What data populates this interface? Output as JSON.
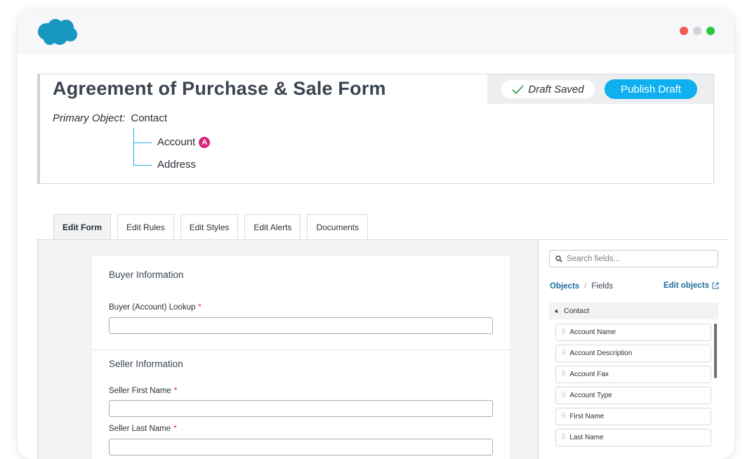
{
  "window": {
    "logo_icon": "salesforce-cloud-logo",
    "controls": [
      {
        "name": "close-dot",
        "color": "#f05b51"
      },
      {
        "name": "minimize-dot",
        "color": "#cfd2d6"
      },
      {
        "name": "maximize-dot",
        "color": "#27c93f"
      }
    ]
  },
  "header": {
    "title": "Agreement of Purchase & Sale Form",
    "draft_status": "Draft Saved",
    "publish_label": "Publish Draft",
    "primary_label": "Primary Object:",
    "primary_value": "Contact",
    "related": [
      {
        "label": "Account",
        "badge": "A"
      },
      {
        "label": "Address"
      }
    ]
  },
  "tabs": [
    "Edit Form",
    "Edit Rules",
    "Edit Styles",
    "Edit Alerts",
    "Documents"
  ],
  "form": {
    "sections": [
      {
        "title": "Buyer Information",
        "fields": [
          {
            "label": "Buyer (Account) Lookup",
            "required": "*",
            "value": ""
          }
        ]
      },
      {
        "title": "Seller Information",
        "fields": [
          {
            "label": "Seller First Name",
            "required": "*",
            "value": ""
          },
          {
            "label": "Seller Last Name",
            "required": "*",
            "value": ""
          }
        ]
      }
    ]
  },
  "panel": {
    "search_placeholder": "Search fields...",
    "crumb_objects": "Objects",
    "crumb_separator": "/",
    "crumb_fields": "Fields",
    "edit_objects": "Edit objects",
    "group": "Contact",
    "fields": [
      "Account Name",
      "Account Description",
      "Account Fax",
      "Account Type",
      "First Name",
      "Last Name"
    ]
  },
  "colors": {
    "accent": "#0fb0ef",
    "link": "#1b6e9c",
    "badge": "#d6237f",
    "required": "#d9322a"
  }
}
